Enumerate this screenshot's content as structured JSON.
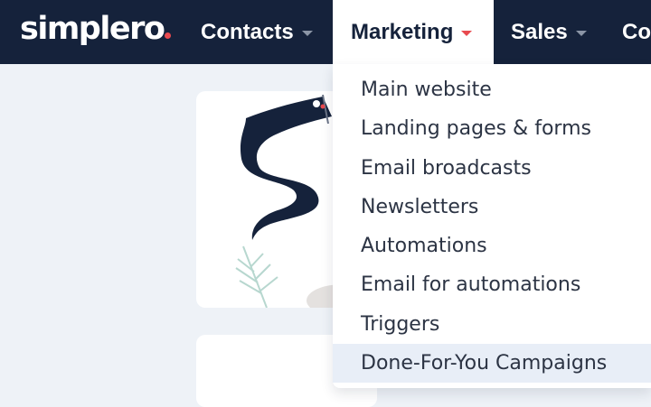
{
  "brand": {
    "logo_text": "simplero",
    "dot_color": "#e84a4f"
  },
  "nav": {
    "items": [
      {
        "label": "Contacts",
        "has_dropdown": true
      },
      {
        "label": "Marketing",
        "has_dropdown": true,
        "active": true
      },
      {
        "label": "Sales",
        "has_dropdown": true
      },
      {
        "label": "Co",
        "has_dropdown": false
      }
    ]
  },
  "marketing_menu": {
    "items": [
      {
        "label": "Main website"
      },
      {
        "label": "Landing pages & forms"
      },
      {
        "label": "Email broadcasts"
      },
      {
        "label": "Newsletters"
      },
      {
        "label": "Automations"
      },
      {
        "label": "Email for automations"
      },
      {
        "label": "Triggers"
      },
      {
        "label": "Done-For-You Campaigns",
        "highlighted": true
      }
    ]
  },
  "colors": {
    "navbar_bg": "#15223b",
    "page_bg": "#eef2f7",
    "accent": "#e84a4f",
    "highlight_bg": "#e8eef7"
  }
}
